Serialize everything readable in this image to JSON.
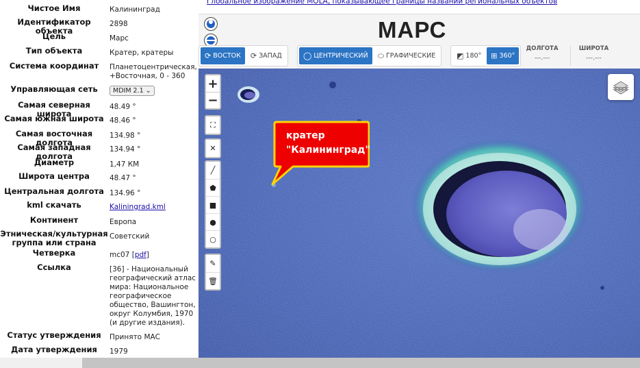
{
  "attributes": [
    {
      "label": "Чистое Имя",
      "value": "Калининград"
    },
    {
      "label": "Идентификатор объекта",
      "value": "2898"
    },
    {
      "label": "Цель",
      "value": "Марс"
    },
    {
      "label": "Тип объекта",
      "value": "Кратер, кратеры"
    },
    {
      "label": "Система координат",
      "value": "Планетоцентрическая, +Восточная, 0 - 360"
    },
    {
      "label": "Управляющая сеть",
      "value": "MDIM 2.1"
    },
    {
      "label": "Самая северная широта",
      "value": "48.49 °"
    },
    {
      "label": "Самая южная широта",
      "value": "48.46 °"
    },
    {
      "label": "Самая восточная долгота",
      "value": "134.98 °"
    },
    {
      "label": "Самая западная долгота",
      "value": "134.94 °"
    },
    {
      "label": "Диаметр",
      "value": "1,47 КМ"
    },
    {
      "label": "Широта центра",
      "value": "48.47 °"
    },
    {
      "label": "Центральная долгота",
      "value": "134.96 °"
    },
    {
      "label": "kml скачать",
      "value": "Kaliningrad.kml"
    },
    {
      "label": "Континент",
      "value": "Европа"
    },
    {
      "label": "Этническая/культурная группа или страна",
      "value": "Советский"
    },
    {
      "label": "Четверка",
      "value": "mc07",
      "extra_link": "pdf"
    },
    {
      "label": "Ссылка",
      "value": "[36] - Национальный географический атлас мира: Национальное географическое общество, Вашингтон, округ Колумбия, 1970 (и другие издания)."
    },
    {
      "label": "Статус утверждения",
      "value": "Принято МАС"
    },
    {
      "label": "Дата утверждения",
      "value": "1979"
    }
  ],
  "map": {
    "link_text": "Глобальное изображение MOLA, показывающее границы названий региональных объектов",
    "title": "МАРС",
    "direction": {
      "east": "ВОСТОК",
      "west": "ЗАПАД"
    },
    "projection": {
      "central": "ЦЕНТРИЧЕСКИЙ",
      "graphic": "ГРАФИЧЕСКИЕ"
    },
    "range": {
      "r180": "180°",
      "r360": "360°"
    },
    "longitude": {
      "label": "ДОЛГОТА",
      "value": "---.---"
    },
    "latitude": {
      "label": "ШИРОТА",
      "value": "---.---"
    },
    "zoom_in": "+",
    "zoom_out": "−",
    "callout_line1": "кратер",
    "callout_line2": "\"Калининград\""
  },
  "colors": {
    "accent": "#2c74c4",
    "callout_fill": "#ee0000",
    "callout_border": "#ffd400",
    "map_blue": "#3a55a8"
  }
}
